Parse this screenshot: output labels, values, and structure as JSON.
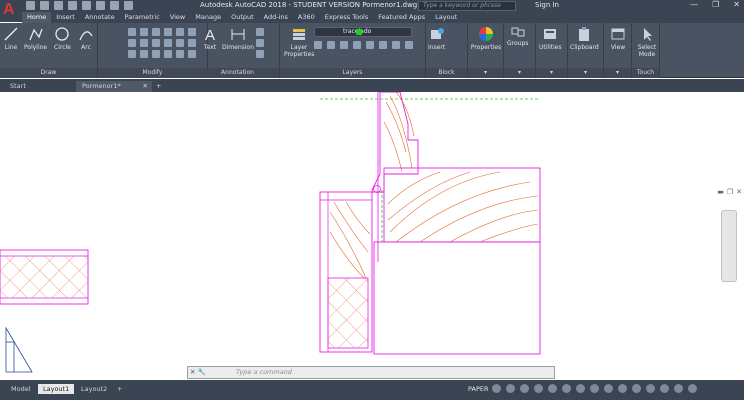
{
  "app": {
    "title": "Autodesk AutoCAD 2018 - STUDENT VERSION   Pormenor1.dwg",
    "logo_letter": "A",
    "search_placeholder": "Type a keyword or phrase",
    "sign_in": "Sign In",
    "window_controls": [
      "—",
      "❐",
      "✕"
    ]
  },
  "ribbon_tabs": [
    "Home",
    "Insert",
    "Annotate",
    "Parametric",
    "View",
    "Manage",
    "Output",
    "Add-ins",
    "A360",
    "Express Tools",
    "Featured Apps",
    "Layout"
  ],
  "active_tab": "Home",
  "panels": {
    "draw": {
      "label": "Draw",
      "buttons": [
        "Line",
        "Polyline",
        "Circle",
        "Arc"
      ]
    },
    "modify": {
      "label": "Modify"
    },
    "annotation": {
      "label": "Annotation",
      "buttons": [
        "Text",
        "Dimension"
      ]
    },
    "layers": {
      "label": "Layers",
      "layer_props": "Layer Properties",
      "current_layer": "tracejado"
    },
    "block": {
      "label": "Block",
      "insert": "Insert"
    },
    "properties": {
      "label": "Properties"
    },
    "groups": {
      "label": "Groups"
    },
    "utilities": {
      "label": "Utilities"
    },
    "clipboard": {
      "label": "Clipboard"
    },
    "view": {
      "label": "View"
    },
    "touch": {
      "label": "Touch",
      "select_mode": "Select Mode"
    }
  },
  "doc_tabs": [
    "Start",
    "Pormenor1*",
    "+"
  ],
  "command_line": {
    "placeholder": "Type a command"
  },
  "layout_tabs": [
    "Model",
    "Layout1",
    "Layout2",
    "+"
  ],
  "status": {
    "paper": "PAPER"
  },
  "colors": {
    "accent_red": "#d93a3a",
    "magenta": "#e61ee6",
    "hatch": "#e8642a",
    "ribbon_bg": "#4a5362",
    "dark_bg": "#3b4453"
  }
}
